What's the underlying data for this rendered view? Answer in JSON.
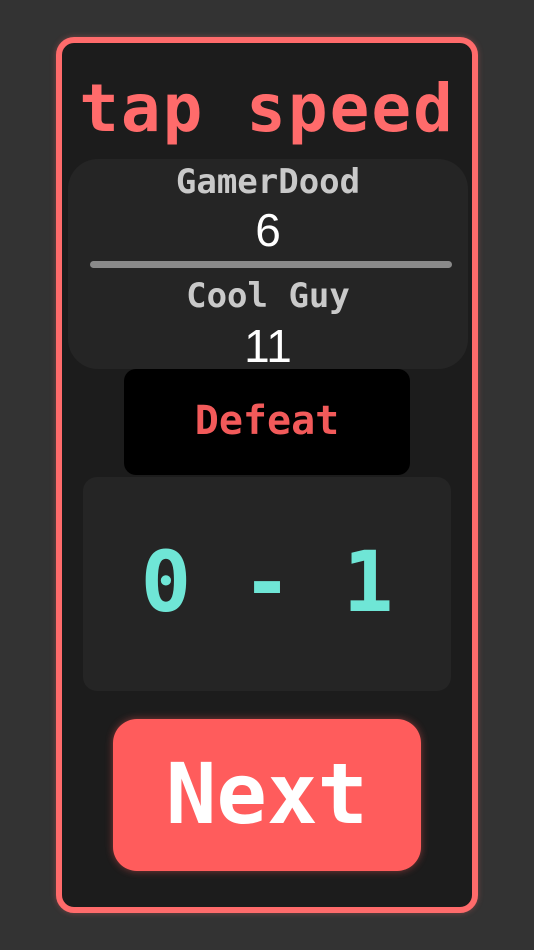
{
  "game": {
    "title": "tap speed"
  },
  "players": [
    {
      "name": "GamerDood",
      "score": "6"
    },
    {
      "name": "Cool Guy",
      "score": "11"
    }
  ],
  "result": {
    "text": "Defeat"
  },
  "tally": {
    "text": "0 - 1"
  },
  "actions": {
    "next_label": "Next"
  },
  "colors": {
    "accent": "#ff6b6b",
    "background": "#333333",
    "panel": "#1c1c1c",
    "tally": "#6fe6d6",
    "result": "#f25a5a"
  }
}
